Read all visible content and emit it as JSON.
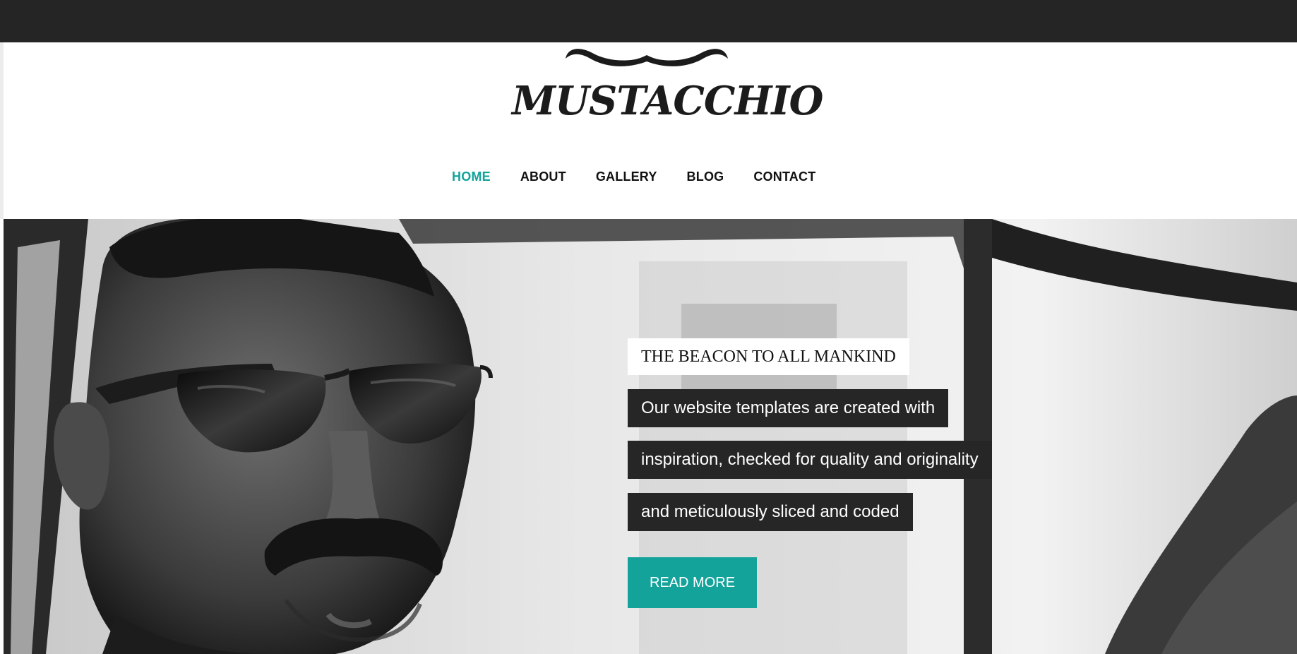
{
  "header": {
    "logo_text": "MUSTACCHIO",
    "logo_icon": "mustache-icon"
  },
  "nav": {
    "items": [
      {
        "label": "HOME",
        "active": true
      },
      {
        "label": "ABOUT",
        "active": false
      },
      {
        "label": "GALLERY",
        "active": false
      },
      {
        "label": "BLOG",
        "active": false
      },
      {
        "label": "CONTACT",
        "active": false
      }
    ]
  },
  "hero": {
    "tagline": "THE BEACON TO ALL MANKIND",
    "lines": [
      "Our website templates are created with",
      "inspiration, checked for quality and originality",
      "and meticulously sliced and coded"
    ],
    "button_label": "READ MORE",
    "image": "man-with-mustache-in-car-photo"
  },
  "colors": {
    "accent": "#13a39a",
    "top_bar": "#252525",
    "text_box": "#262626"
  }
}
